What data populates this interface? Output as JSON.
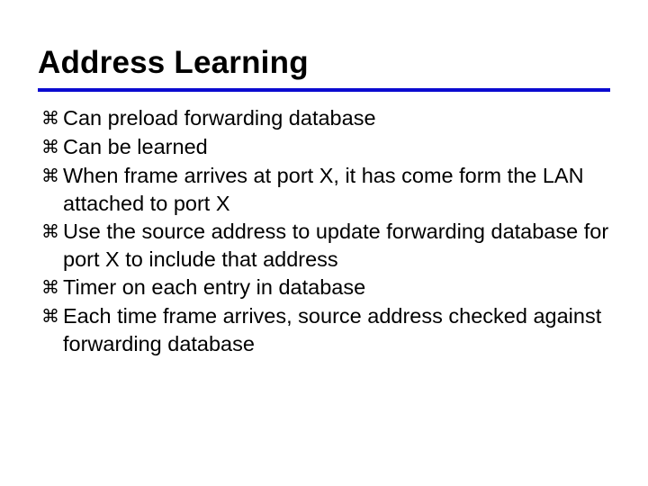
{
  "slide": {
    "title": "Address Learning",
    "bullets": [
      "Can preload forwarding database",
      "Can be learned",
      "When frame arrives at port X, it has come form the LAN attached to port X",
      "Use the source address to update forwarding database for port X to include that address",
      "Timer on each entry in database",
      "Each time frame arrives, source address checked against forwarding database"
    ],
    "bullet_glyph": "⌘"
  }
}
